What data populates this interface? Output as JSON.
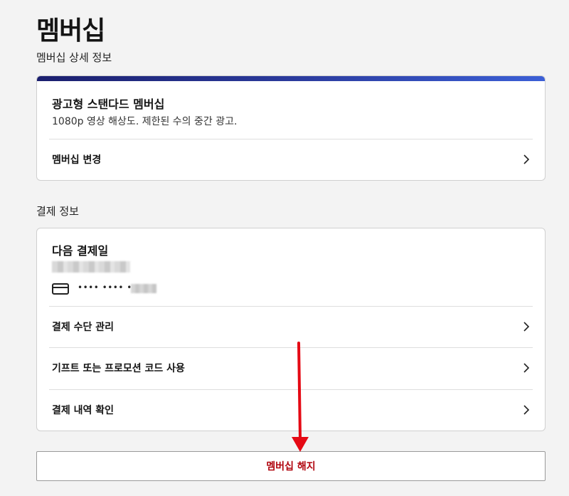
{
  "page": {
    "title": "멤버십",
    "membership_section_label": "멤버십 상세 정보",
    "payment_section_label": "결제 정보"
  },
  "plan": {
    "name": "광고형 스탠다드 멤버십",
    "description": "1080p 영상 해상도. 제한된 수의 중간 광고.",
    "change_label": "멤버십 변경",
    "accent_color": "#2a3a9c"
  },
  "payment": {
    "next_billing_title": "다음 결제일",
    "card_masked": "•••• •••• ••••",
    "rows": [
      {
        "label": "결제 수단 관리"
      },
      {
        "label": "기프트 또는 프로모션 코드 사용"
      },
      {
        "label": "결제 내역 확인"
      }
    ]
  },
  "actions": {
    "cancel_label": "멤버십 해지",
    "cancel_color": "#b1060f"
  },
  "annotation": {
    "arrow_color": "#e50914"
  },
  "icons": {
    "chevron": "chevron-right-icon",
    "card": "credit-card-icon"
  }
}
